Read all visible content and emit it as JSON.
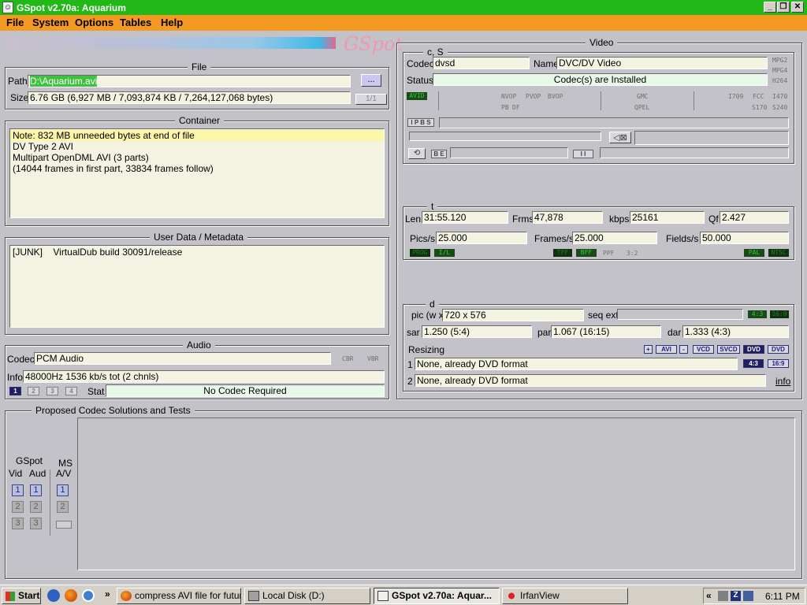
{
  "window": {
    "title": "GSpot v2.70a: Aquarium",
    "app_icon": "gspot-app-icon",
    "minimize_glyph": "_",
    "restore_glyph": "❐",
    "close_glyph": "✕"
  },
  "menu": [
    "File",
    "System",
    "Options",
    "Tables",
    "Help"
  ],
  "logo_text": "GSpot",
  "file": {
    "title": "File",
    "path_label": "Path",
    "path_value": "D:\\Aquarium.avi",
    "browse_label": "...",
    "size_label": "Size",
    "size_value": "6.76 GB (6,927 MB / 7,093,874 KB / 7,264,127,068 bytes)",
    "part_label": "1/1"
  },
  "container": {
    "title": "Container",
    "lines": [
      "Note: 832 MB unneeded bytes at end of file",
      "DV Type 2 AVI",
      "Multipart OpenDML AVI (3 parts)",
      "(14044 frames in first part, 33834 frames follow)"
    ],
    "highlight_color": "#fcf6a8"
  },
  "userdata": {
    "title": "User Data / Metadata",
    "tag": "[JUNK]",
    "value": "VirtualDub build 30091/release"
  },
  "audio": {
    "title": "Audio",
    "codec_label": "Codec",
    "codec_value": "PCM Audio",
    "cbr": "CBR",
    "vbr": "VBR",
    "info_label": "Info",
    "info_value": "48000Hz  1536 kb/s tot (2 chnls)",
    "streams": [
      "1",
      "2",
      "3",
      "4"
    ],
    "stat_label": "Stat",
    "stat_value": "No Codec Required"
  },
  "video": {
    "title": "Video",
    "cs_title": "c, S",
    "codec_label": "Codec",
    "codec_value": "dvsd",
    "name_label": "Name",
    "name_value": "DVC/DV Video",
    "status_label": "Status",
    "status_value": "Codec(s) are Installed",
    "formats": [
      "MPG2",
      "MPG4",
      "H264"
    ],
    "avid": "AVID",
    "flags_row1": [
      "NVOP",
      "PVOP",
      "BVOP",
      "GMC",
      "I709",
      "FCC",
      "I470"
    ],
    "flags_row2": [
      "PB",
      "DF",
      "QPEL",
      "S170",
      "S240"
    ],
    "ipbs": "I P B S",
    "be": "B E",
    "ii": "I I"
  },
  "timing": {
    "title": "t",
    "len_label": "Len",
    "len_value": "31:55.120",
    "frms_label": "Frms",
    "frms_value": "47,878",
    "kbps_label": "kbps",
    "kbps_value": "25161",
    "qf_label": "Qf",
    "qf_value": "2.427",
    "pics_label": "Pics/s",
    "pics_value": "25.000",
    "frames_label": "Frames/s",
    "frames_value": "25.000",
    "fields_label": "Fields/s",
    "fields_value": "50.000",
    "prog": "PROG",
    "il": "I/L",
    "tff": "TFF",
    "bff": "BFF",
    "ppf": "PPF",
    "ratio32": "3:2",
    "pal": "PAL",
    "ntsc": "NTSC"
  },
  "dims": {
    "title": "d",
    "pic_label": "pic (w x",
    "pic_value": "720 x 576",
    "seq_label": "seq ext",
    "ar43": "4:3",
    "ar169": "16:9",
    "sar_label": "sar",
    "sar_value": "1.250 (5:4)",
    "par_label": "par",
    "par_value": "1.067 (16:15)",
    "dar_label": "dar",
    "dar_value": "1.333 (4:3)",
    "resizing_label": "Resizing",
    "resize_buttons": [
      "+",
      "AVI",
      "-",
      "VCD",
      "SVCD",
      "DVD",
      "DVD"
    ],
    "row1_num": "1",
    "row1_value": "None, already DVD format",
    "row2_num": "2",
    "row2_value": "None, already DVD format",
    "info_link": "info"
  },
  "proposed": {
    "title": "Proposed Codec Solutions and Tests",
    "gspot_label": "GSpot",
    "vid_label": "Vid",
    "aud_label": "Aud",
    "ms_label": "MS",
    "av_label": "A/V",
    "buttons": [
      "1",
      "2",
      "3"
    ]
  },
  "taskbar": {
    "start": "Start",
    "chevron": "»",
    "items": [
      "compress AVI file for futur...",
      "Local Disk (D:)",
      "GSpot v2.70a: Aquar...",
      "IrfanView"
    ],
    "tray_chevron": "«",
    "clock": "6:11 PM"
  }
}
